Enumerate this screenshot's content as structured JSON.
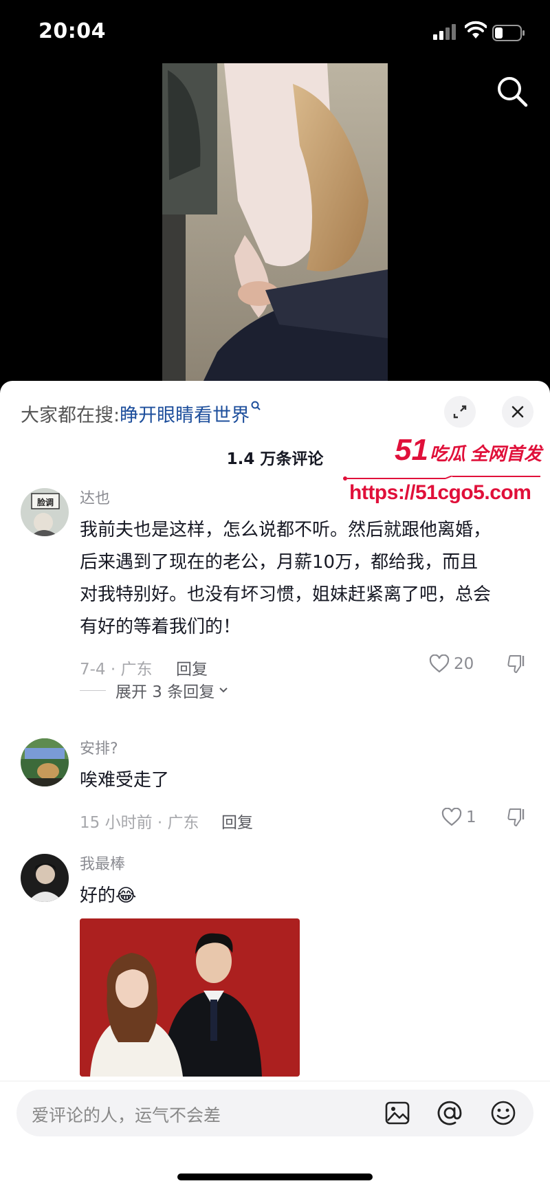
{
  "status_bar": {
    "time": "20:04"
  },
  "sheet": {
    "hot_search_prefix": "大家都在搜:",
    "hot_search_term": "睁开眼睛看世界",
    "comment_count": "1.4 万条评论"
  },
  "watermark": {
    "brand_num": "51",
    "brand_text": "吃瓜 全网首发",
    "url": "https://51cgo5.com"
  },
  "comments": [
    {
      "user": "达也",
      "avatar_text": "脸调",
      "text_lines": [
        "我前夫也是这样，怎么说都不听。然后就跟他离婚，",
        "后来遇到了现在的老公，月薪10万，都给我，而且",
        "对我特别好。也没有坏习惯，姐妹赶紧离了吧，总会",
        "有好的等着我们的！"
      ],
      "date_location": "7-4 · 广东",
      "reply_label": "回复",
      "likes": "20",
      "expand_replies": "展开 3 条回复"
    },
    {
      "user": "安排?",
      "text": "唉难受走了",
      "date_location": "15 小时前 · 广东",
      "reply_label": "回复",
      "likes": "1"
    },
    {
      "user": "我最棒",
      "text": "好的",
      "emoji": "😂"
    }
  ],
  "input": {
    "placeholder": "爱评论的人，运气不会差"
  },
  "colors": {
    "accent_blue": "#1e4f9c",
    "watermark_red": "#e0103a",
    "text_primary": "#161823",
    "text_secondary": "#8a8b91"
  }
}
